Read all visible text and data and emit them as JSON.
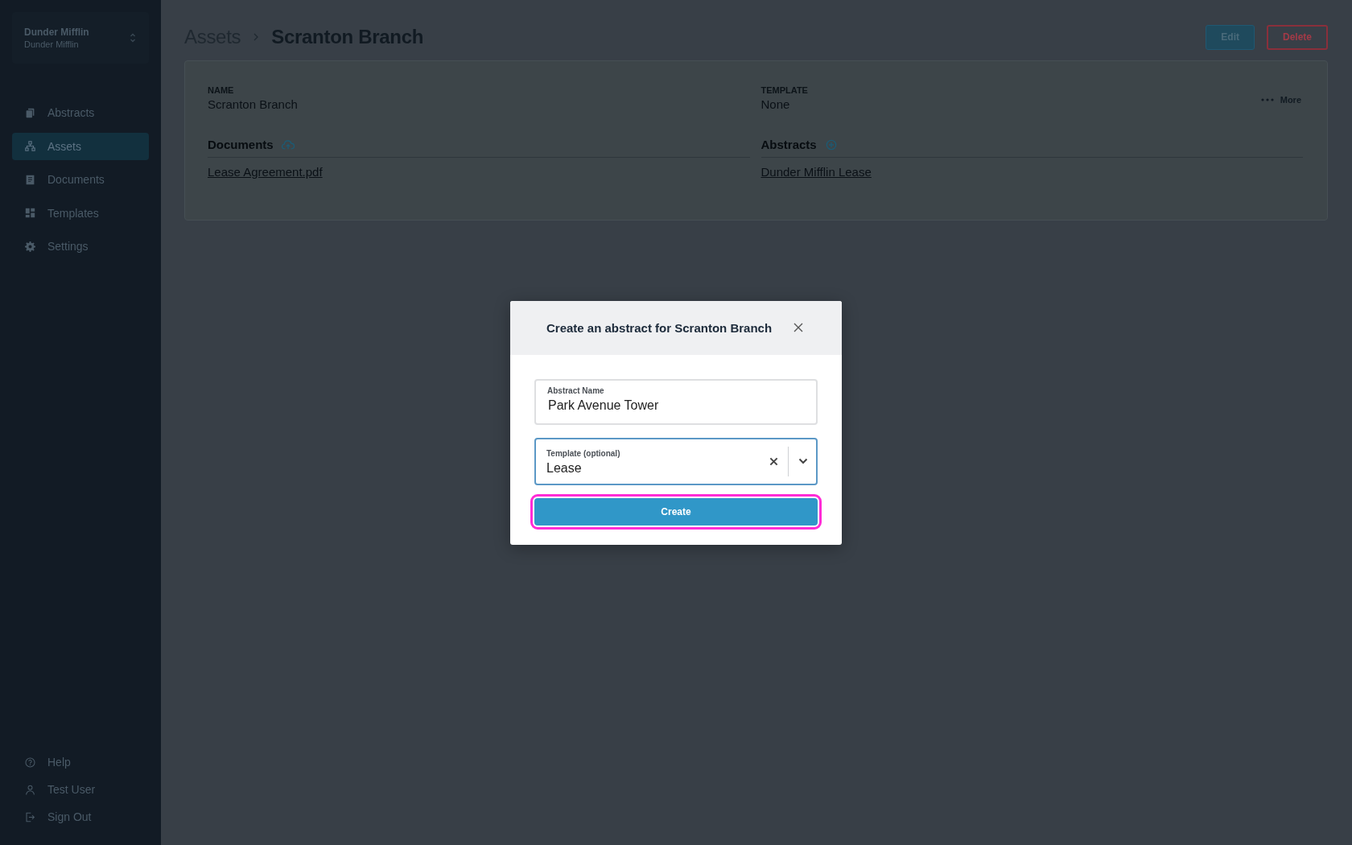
{
  "sidebar": {
    "org": {
      "name": "Dunder Mifflin",
      "subtitle": "Dunder Mifflin"
    },
    "nav": [
      {
        "label": "Abstracts",
        "selected": false
      },
      {
        "label": "Assets",
        "selected": true
      },
      {
        "label": "Documents",
        "selected": false
      },
      {
        "label": "Templates",
        "selected": false
      },
      {
        "label": "Settings",
        "selected": false
      }
    ],
    "footer": [
      {
        "label": "Help"
      },
      {
        "label": "Test User"
      },
      {
        "label": "Sign Out"
      }
    ]
  },
  "header": {
    "breadcrumb": [
      "Assets",
      "Scranton Branch"
    ],
    "actions": [
      {
        "label": "Edit",
        "kind": "primary"
      },
      {
        "label": "Delete",
        "kind": "danger"
      }
    ]
  },
  "asset": {
    "fields": [
      {
        "label": "NAME",
        "value": "Scranton Branch"
      },
      {
        "label": "TEMPLATE",
        "value": "None"
      }
    ],
    "more": "More",
    "sections": [
      {
        "title": "Documents",
        "items": [
          "Lease Agreement.pdf"
        ]
      },
      {
        "title": "Abstracts",
        "items": [
          "Dunder Mifflin Lease"
        ]
      }
    ]
  },
  "dialog": {
    "title": "Create an abstract for Scranton Branch",
    "fields": [
      {
        "kind": "text",
        "label": "Abstract Name",
        "value": "Park Avenue Tower",
        "focused": false
      },
      {
        "kind": "select",
        "label": "Template (optional)",
        "value": "Lease",
        "focused": true
      }
    ],
    "submit": {
      "label": "Create",
      "focused": true
    }
  }
}
